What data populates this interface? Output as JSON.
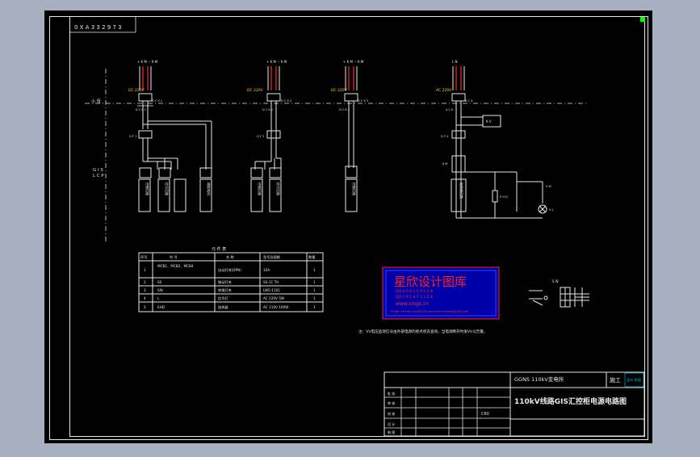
{
  "sheet": {
    "corner_code": "0 Ⅹ A  3 3 2  9 7 3"
  },
  "circuits": [
    {
      "voltage": "DC 220V",
      "top_labels": "+ K M  − K M",
      "breaker_label": "D C X 1",
      "bus_labels": "D C K 1",
      "sub_breaker_label": "Q F 1",
      "sub_labels": "K C",
      "loads": [
        "控制回路",
        "信号回路",
        "储能电机"
      ]
    },
    {
      "voltage": "DC 220V",
      "top_labels": "+ K M  − K M",
      "breaker_label": "D C X 2",
      "bus_labels": "D C K 2",
      "sub_breaker_label": "Q F 2",
      "sub_labels": "K C",
      "loads": [
        "控制回路",
        "信号回路"
      ]
    },
    {
      "voltage": "DC 220V",
      "top_labels": "+ K M  − K M",
      "breaker_label": "D C X 3",
      "bus_labels": "D C K 3",
      "loads": [
        "控制回路"
      ]
    },
    {
      "voltage": "AC 220V",
      "top_labels": "L   N",
      "breaker_label": "A C X",
      "bus_labels": "A C K",
      "sub_breaker_label": "Q F 4",
      "relay_label": "K V",
      "contactor_label": "K M",
      "heater_label": "E H D",
      "switch_label": "S W",
      "lamp_label": "H L",
      "loads": [
        "加热器回路"
      ]
    }
  ],
  "left_labels": {
    "bus": "小 母",
    "gis": "G I S",
    "lcp": "L C P"
  },
  "equipment_table": {
    "title": "元  件  表",
    "headers": [
      "序号",
      "符    号",
      "名    称",
      "型号及规格",
      "数量"
    ],
    "rows": [
      {
        "no": "1",
        "symbol": "MCB1、MCB2、MCB4",
        "name": "自动开关(DPN)",
        "spec": "10A",
        "qty": "1"
      },
      {
        "no": "2",
        "symbol": "SS",
        "name": "微动开关",
        "spec": "SS-1C TH",
        "qty": "1"
      },
      {
        "no": "3",
        "symbol": "SW",
        "name": "转换开关",
        "spec": "LW5-1101",
        "qty": "1"
      },
      {
        "no": "4",
        "symbol": "L",
        "name": "信号灯",
        "spec": "AC 220V   5W",
        "qty": "1"
      },
      {
        "no": "5",
        "symbol": "EHD",
        "name": "加热器",
        "spec": "AC 110V 100W",
        "qty": "1"
      }
    ]
  },
  "watermark": {
    "title": "星欣设计图库",
    "line1": "QQ:4 0 8 1 5 8 5 3 8",
    "line2": "QQ:1 9 5 4 7 1 2 5 8",
    "url": "www.xings.cn",
    "email": "Email: alichen.cool@163.com/msn:xinsang@163.com"
  },
  "switch_diagram": {
    "label": "S W"
  },
  "note": "注：VV电压监测信号由外部电源的接点状态查询，当电源断开时发VV以告警。",
  "title_block": {
    "project": "GGNS 110kV变电所",
    "stage": "施工",
    "phase_badge": "设计\n阶段",
    "drawing_title": "110kV线路GIS汇控柜电源电路图",
    "sheet_no": "C60",
    "rows": [
      "批 准",
      "审 核",
      "校 核",
      "设 计",
      "制 图"
    ]
  },
  "colors": {
    "background": "#000000",
    "lines": "#e8e8e8",
    "feeder": "#ff2a2a",
    "watermark_bg": "#0000a8",
    "watermark_text": "#ff2020",
    "corner_marker": "#00ff00"
  }
}
